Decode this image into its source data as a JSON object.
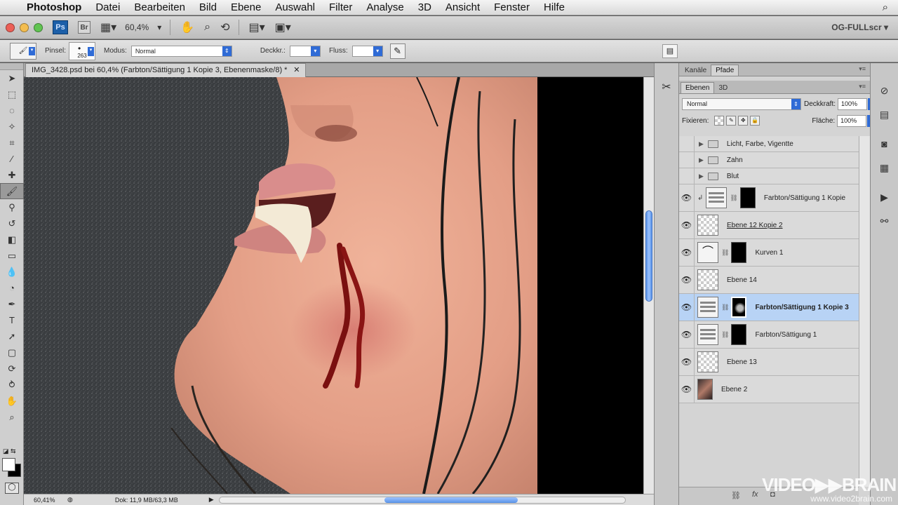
{
  "menubar": {
    "app": "Photoshop",
    "items": [
      "Datei",
      "Bearbeiten",
      "Bild",
      "Ebene",
      "Auswahl",
      "Filter",
      "Analyse",
      "3D",
      "Ansicht",
      "Fenster",
      "Hilfe"
    ]
  },
  "appbar": {
    "ps_label": "Ps",
    "br_label": "Br",
    "zoom": "60,4%",
    "workspace": "OG-FULLscr ▾"
  },
  "options": {
    "brush_label": "Pinsel:",
    "brush_size": "263",
    "mode_label": "Modus:",
    "mode_value": "Normal",
    "opacity_label": "Deckkr.:",
    "flow_label": "Fluss:"
  },
  "document": {
    "tab_title": "IMG_3428.psd bei 60,4% (Farbton/Sättigung 1 Kopie 3, Ebenenmaske/8) *",
    "close": "✕"
  },
  "status": {
    "zoom": "60,41%",
    "doc_info": "Dok: 11,9 MB/63,3 MB"
  },
  "panels": {
    "tabs_top": [
      "Kanäle",
      "Pfade"
    ],
    "tabs_layers": [
      "Ebenen",
      "3D"
    ],
    "blend_mode": "Normal",
    "opacity_label": "Deckkraft:",
    "opacity_value": "100%",
    "lock_label": "Fixieren:",
    "fill_label": "Fläche:",
    "fill_value": "100%"
  },
  "layers": [
    {
      "name": "Licht, Farbe, Vigentte",
      "kind": "group"
    },
    {
      "name": "Zahn",
      "kind": "group"
    },
    {
      "name": "Blut",
      "kind": "group"
    },
    {
      "name": "Farbton/Sättigung 1 Kopie",
      "kind": "adjust"
    },
    {
      "name": "Ebene 12 Kopie 2",
      "kind": "pixel"
    },
    {
      "name": "Kurven 1",
      "kind": "curves"
    },
    {
      "name": "Ebene 14",
      "kind": "pixel"
    },
    {
      "name": "Farbton/Sättigung 1 Kopie 3",
      "kind": "adjust",
      "selected": true
    },
    {
      "name": "Farbton/Sättigung 1",
      "kind": "adjust"
    },
    {
      "name": "Ebene 13",
      "kind": "pixel"
    },
    {
      "name": "Ebene 2",
      "kind": "photo"
    }
  ],
  "watermark": {
    "brand": "VIDEO▶▶BRAIN",
    "url": "www.video2brain.com"
  },
  "colors": {
    "accent": "#2f6bd6",
    "selection": "#b8d3f5",
    "skin": "#e7a78f"
  }
}
